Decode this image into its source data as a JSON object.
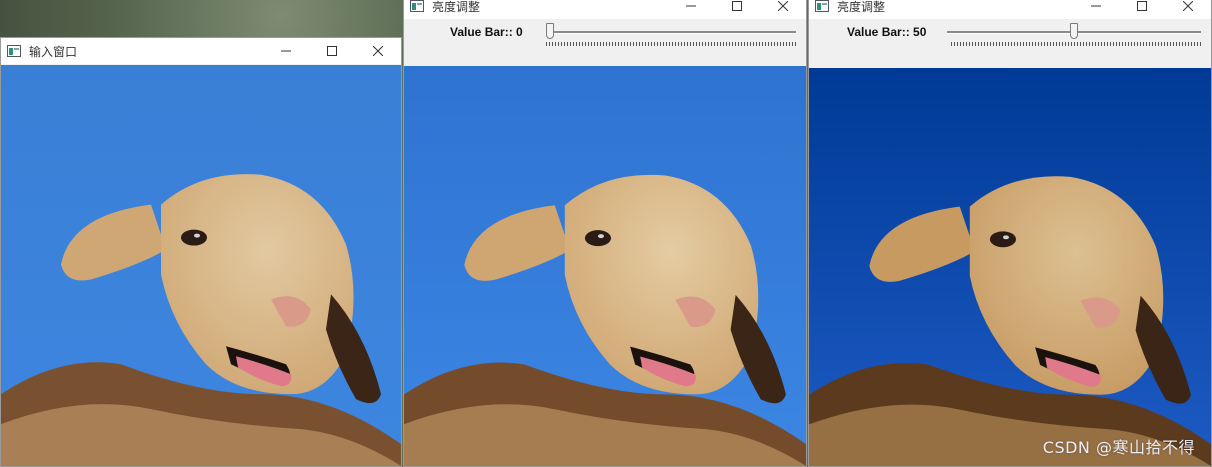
{
  "windows": [
    {
      "title": "输入窗口",
      "brightness": "normal",
      "sky_top": "#3a7fd6",
      "sky_bottom": "#3d86e0",
      "face": "#cfa774",
      "face_light": "#e2c9a0",
      "fur_dark": "#7a5130"
    },
    {
      "title": "亮度调整",
      "trackbar": {
        "label": "Value Bar::",
        "value": "0",
        "fraction": 0
      },
      "sky_top": "#2f73d0",
      "sky_bottom": "#3c86e4",
      "face": "#cfa571",
      "face_light": "#e4cca2",
      "fur_dark": "#744c2c"
    },
    {
      "title": "亮度调整",
      "trackbar": {
        "label": "Value Bar::",
        "value": "50",
        "fraction": 0.5
      },
      "sky_top": "#003a96",
      "sky_bottom": "#1d5bc4",
      "face": "#c79a62",
      "face_light": "#dcc092",
      "fur_dark": "#5c3a1e"
    }
  ],
  "watermark": "CSDN @寒山拾不得"
}
